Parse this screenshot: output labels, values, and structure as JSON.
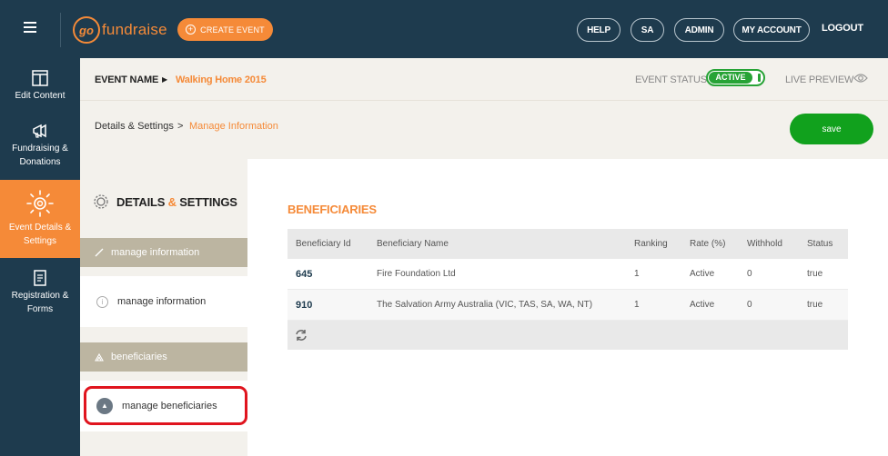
{
  "topbar": {
    "logo_mark": "go",
    "logo_text": "fundraise",
    "create_event_label": "CREATE EVENT",
    "buttons": [
      "HELP",
      "SA",
      "ADMIN",
      "MY ACCOUNT"
    ],
    "logout_label": "LOGOUT"
  },
  "sidebar": {
    "items": [
      {
        "label": "Edit Content",
        "icon": "layout-icon"
      },
      {
        "label": "Fundraising & Donations",
        "icon": "megaphone-icon"
      },
      {
        "label": "Event Details & Settings",
        "icon": "gear-icon"
      },
      {
        "label": "Registration & Forms",
        "icon": "document-icon"
      }
    ]
  },
  "event_header": {
    "event_name_label": "EVENT NAME",
    "event_name": "Walking Home 2015",
    "status_label": "EVENT STATUS",
    "status_value": "ACTIVE",
    "live_preview_label": "LIVE PREVIEW"
  },
  "breadcrumb": {
    "items": [
      "Details & Settings",
      "Manage Information"
    ],
    "separator": ">"
  },
  "save_label": "save",
  "left_panel": {
    "title_part1": "DETAILS",
    "title_amp": "&",
    "title_part2": "SETTINGS",
    "sections": [
      {
        "header": "manage information",
        "item": "manage information"
      },
      {
        "header": "beneficiaries",
        "item": "manage beneficiaries"
      }
    ]
  },
  "content": {
    "title": "BENEFICIARIES",
    "columns": [
      "Beneficiary Id",
      "Beneficiary Name",
      "Ranking",
      "Rate (%)",
      "Withhold",
      "Status"
    ],
    "rows": [
      [
        "645",
        "Fire Foundation Ltd",
        "1",
        "Active",
        "0",
        "true"
      ],
      [
        "910",
        "The Salvation Army Australia (VIC, TAS, SA, WA, NT)",
        "1",
        "Active",
        "0",
        "true"
      ]
    ]
  },
  "colors": {
    "navy": "#1e3b4e",
    "orange": "#f58a38",
    "green": "#11a11d",
    "section_tan": "#bcb5a1",
    "highlight_red": "#e0141e"
  }
}
